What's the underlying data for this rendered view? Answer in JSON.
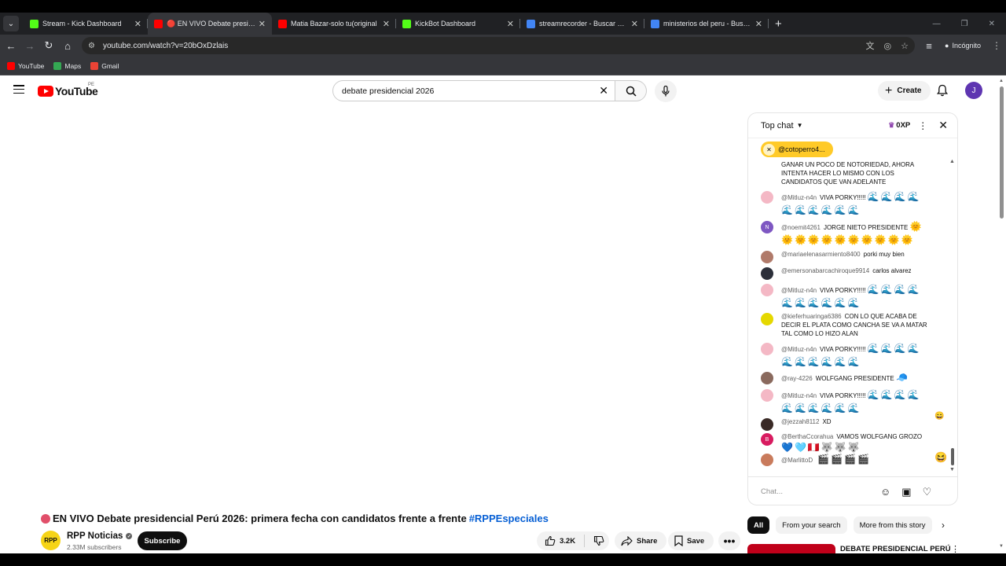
{
  "browser": {
    "tabs": [
      {
        "title": "Stream - Kick Dashboard",
        "color": "#53fc18",
        "active": false
      },
      {
        "title": "🔴 EN VIVO Debate presidencial",
        "color": "#ff0000",
        "active": true
      },
      {
        "title": "Matia Bazar-solo tu(original",
        "color": "#ff0000",
        "active": false
      },
      {
        "title": "KickBot Dashboard",
        "color": "#53fc18",
        "active": false
      },
      {
        "title": "streamrecorder - Buscar con Goo",
        "color": "#4285f4",
        "active": false
      },
      {
        "title": "ministerios del peru - Buscar co",
        "color": "#4285f4",
        "active": false
      }
    ],
    "url": "youtube.com/watch?v=20bOxDzlais",
    "profile": "Incógnito",
    "bookmarks": [
      {
        "label": "YouTube",
        "color": "#ff0000"
      },
      {
        "label": "Maps",
        "color": "#34a853"
      },
      {
        "label": "Gmail",
        "color": "#ea4335"
      }
    ]
  },
  "masthead": {
    "logo_text": "YouTube",
    "country_code": "PE",
    "search_value": "debate presidencial 2026",
    "create_label": "Create",
    "avatar_letter": "J"
  },
  "video": {
    "title": "EN VIVO Debate presidencial Perú 2026: primera fecha con candidatos frente a frente",
    "hashtag": "#RPPEspeciales",
    "channel_name": "RPP Noticias",
    "channel_avatar_text": "RPP",
    "subscribers": "2.33M subscribers",
    "subscribe_label": "Subscribe",
    "likes": "3.2K",
    "share_label": "Share",
    "save_label": "Save"
  },
  "chat": {
    "mode_label": "Top chat",
    "xp": "0XP",
    "pinned_user": "@cotoperro4...",
    "input_placeholder": "Chat...",
    "messages": [
      {
        "author": "",
        "text": "GANAR UN POCO DE NOTORIEDAD, AHORA INTENTA HACER LO MISMO CON LOS CANDIDATOS QUE VAN ADELANTE",
        "emoji": "",
        "avatar": "",
        "color": ""
      },
      {
        "author": "@Mitluz-n4n",
        "text": "VIVA PORKY!!!!!",
        "emoji": "🌊🌊🌊🌊🌊🌊🌊🌊🌊🌊",
        "avatar": "",
        "color": "#f4b8c5"
      },
      {
        "author": "@noemit4261",
        "text": "JORGE NIETO PRESIDENTE",
        "emoji": "🌞🌞🌞🌞🌞🌞🌞🌞🌞🌞🌞",
        "avatar": "N",
        "color": "#7e57c2"
      },
      {
        "author": "@mariaelenasarmiento8400",
        "text": "porki muy bien",
        "emoji": "",
        "avatar": "",
        "color": "#b07a6a"
      },
      {
        "author": "@emersonabarcachiroque9914",
        "text": "carlos alvarez",
        "emoji": "",
        "avatar": "",
        "color": "#2c2f3a"
      },
      {
        "author": "@Mitluz-n4n",
        "text": "VIVA PORKY!!!!!",
        "emoji": "🌊🌊🌊🌊🌊🌊🌊🌊🌊🌊",
        "avatar": "",
        "color": "#f4b8c5"
      },
      {
        "author": "@kieferhuaringa6386",
        "text": "CON LO QUE ACABA DE DECIR EL PLATA COMO CANCHA SE VA A MATAR TAL COMO LO HIZO ALAN",
        "emoji": "",
        "avatar": "",
        "color": "#e5d800"
      },
      {
        "author": "@Mitluz-n4n",
        "text": "VIVA PORKY!!!!!",
        "emoji": "🌊🌊🌊🌊🌊🌊🌊🌊🌊🌊",
        "avatar": "",
        "color": "#f4b8c5"
      },
      {
        "author": "@ray-4226",
        "text": "WOLFGANG PRESIDENTE",
        "emoji": "🧢",
        "avatar": "",
        "color": "#8a6a5e"
      },
      {
        "author": "@Mitluz-n4n",
        "text": "VIVA PORKY!!!!!",
        "emoji": "🌊🌊🌊🌊🌊🌊🌊🌊🌊🌊",
        "avatar": "",
        "color": "#f4b8c5"
      },
      {
        "author": "@jezzah8112",
        "text": "XD",
        "emoji": "",
        "avatar": "",
        "color": "#3a2a26"
      },
      {
        "author": "@BerthaCcorahua",
        "text": "VAMOS WOLFGANG GROZO",
        "emoji": "💙🩵🇵🇪🐺🐺🐺",
        "avatar": "B",
        "color": "#d81b60"
      },
      {
        "author": "@MarlittoD",
        "text": "",
        "emoji": "🎬🎬🎬🎬",
        "avatar": "",
        "color": "#c97b5c"
      }
    ]
  },
  "filters": {
    "chips": [
      "All",
      "From your search",
      "More from this story"
    ],
    "active_chip": "All"
  },
  "related": {
    "first_title": "DEBATE PRESIDENCIAL PERÚ"
  }
}
